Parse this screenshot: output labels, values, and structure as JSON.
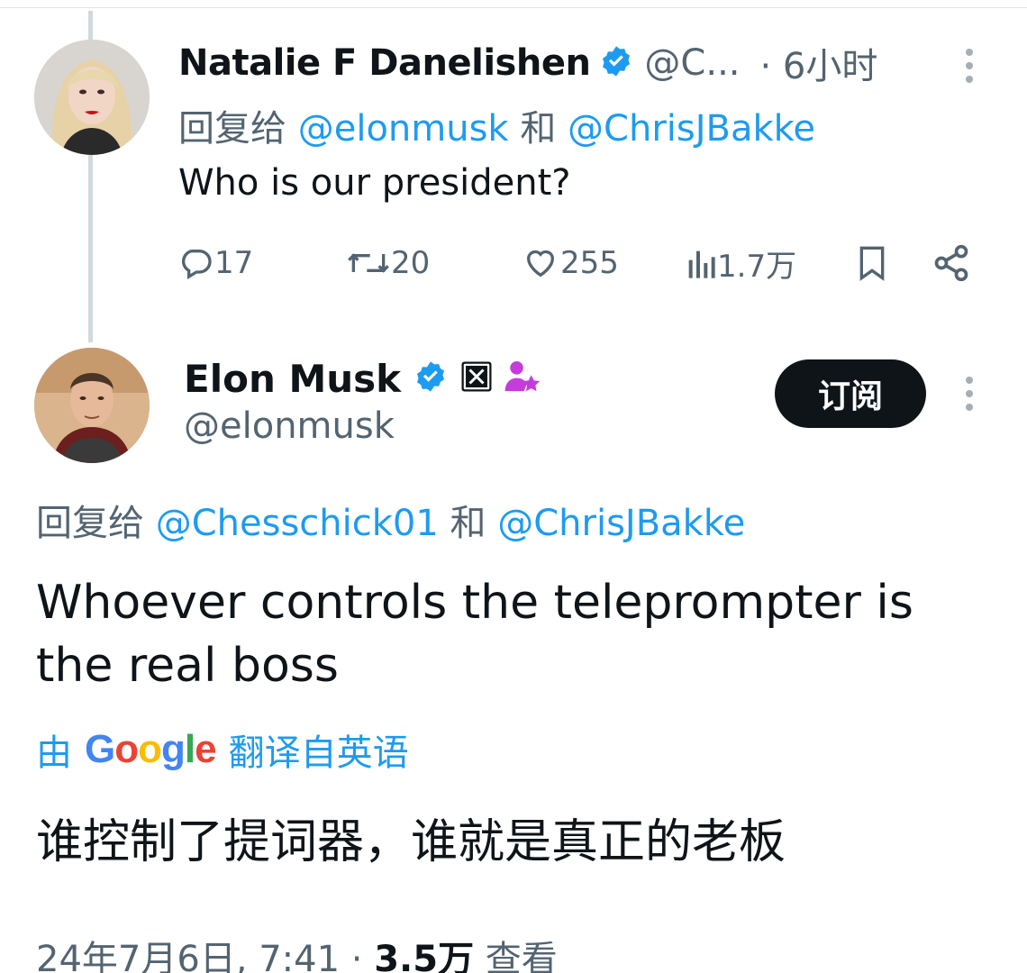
{
  "tweet1": {
    "author_name": "Natalie F Danelishen",
    "handle": "@C...",
    "time": "· 6小时",
    "reply_prefix": "回复给",
    "reply_mention1": "@elonmusk",
    "reply_joiner": "和",
    "reply_mention2": "@ChrisJBakke",
    "text": "Who is our president?",
    "stats": {
      "replies": "17",
      "retweets": "20",
      "likes": "255",
      "views": "1.7万"
    }
  },
  "tweet2": {
    "author_name": "Elon Musk",
    "handle": "@elonmusk",
    "subscribe_label": "订阅",
    "reply_prefix": "回复给",
    "reply_mention1": "@Chesschick01",
    "reply_joiner": "和",
    "reply_mention2": "@ChrisJBakke",
    "text": "Whoever controls the teleprompter is the real boss",
    "translation": {
      "by_label": "由",
      "provider": "Google",
      "from_label": "翻译自英语",
      "text": "谁控制了提词器，谁就是真正的老板"
    },
    "footer": {
      "datetime": "24年7月6日, 7:41 ·",
      "views_count": "3.5万",
      "views_label": "查看"
    }
  },
  "colors": {
    "accent": "#1d9bf0",
    "muted": "#536471",
    "text": "#0f1419",
    "affiliate_purple": "#c43dda"
  },
  "icons": [
    "verified-badge-icon",
    "reply-icon",
    "retweet-icon",
    "like-icon",
    "views-icon",
    "bookmark-icon",
    "share-icon",
    "x-affiliate-icon",
    "affiliate-star-icon",
    "more-options-icon"
  ]
}
